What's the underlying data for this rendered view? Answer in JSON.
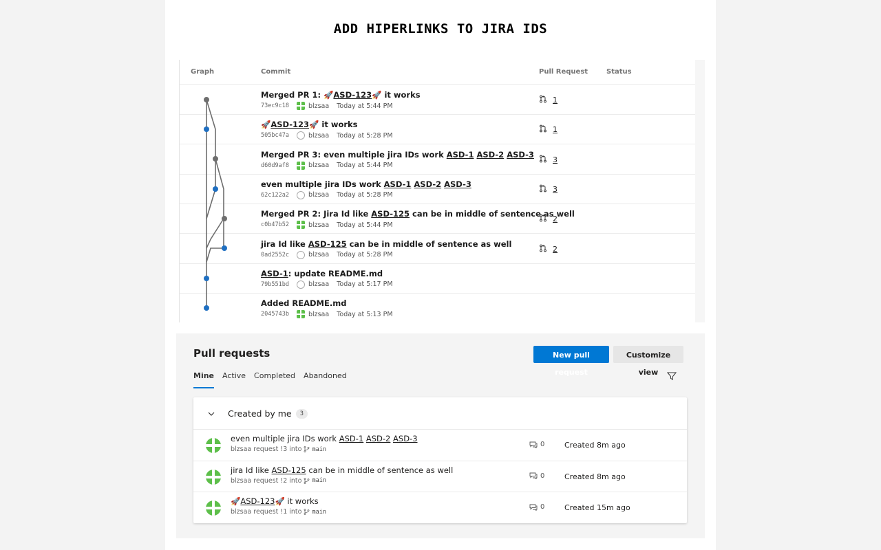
{
  "page_title": "ADD HIPERLINKS TO JIRA IDS",
  "commits_table": {
    "columns": {
      "graph": "Graph",
      "commit": "Commit",
      "pull_request": "Pull Request",
      "status": "Status"
    },
    "rows": [
      {
        "parts": [
          {
            "t": "Merged PR 1: 🚀"
          },
          {
            "l": "ASD-123"
          },
          {
            "t": "🚀 it works"
          }
        ],
        "hash": "73ec9c18",
        "avatar": "green",
        "author": "blzsaa",
        "time": "Today at 5:44 PM",
        "pr": "1"
      },
      {
        "parts": [
          {
            "t": "🚀"
          },
          {
            "l": "ASD-123"
          },
          {
            "t": "🚀 it works"
          }
        ],
        "hash": "505bc47a",
        "avatar": "grey",
        "author": "blzsaa",
        "time": "Today at 5:28 PM",
        "pr": "1"
      },
      {
        "parts": [
          {
            "t": "Merged PR 3: even multiple jira IDs work "
          },
          {
            "l": "ASD-1"
          },
          {
            "t": " "
          },
          {
            "l": "ASD-2"
          },
          {
            "t": " "
          },
          {
            "l": "ASD-3"
          }
        ],
        "hash": "d60d9af8",
        "avatar": "green",
        "author": "blzsaa",
        "time": "Today at 5:44 PM",
        "pr": "3"
      },
      {
        "parts": [
          {
            "t": "even multiple jira IDs work "
          },
          {
            "l": "ASD-1"
          },
          {
            "t": " "
          },
          {
            "l": "ASD-2"
          },
          {
            "t": " "
          },
          {
            "l": "ASD-3"
          }
        ],
        "hash": "62c122a2",
        "avatar": "grey",
        "author": "blzsaa",
        "time": "Today at 5:28 PM",
        "pr": "3"
      },
      {
        "parts": [
          {
            "t": "Merged PR 2: Jira Id like "
          },
          {
            "l": "ASD-125"
          },
          {
            "t": " can be in middle of sentence as well"
          }
        ],
        "hash": "c0b47b52",
        "avatar": "green",
        "author": "blzsaa",
        "time": "Today at 5:44 PM",
        "pr": "2"
      },
      {
        "parts": [
          {
            "t": "jira Id like "
          },
          {
            "l": "ASD-125"
          },
          {
            "t": " can be in middle of sentence as well"
          }
        ],
        "hash": "0ad2552c",
        "avatar": "grey",
        "author": "blzsaa",
        "time": "Today at 5:28 PM",
        "pr": "2"
      },
      {
        "parts": [
          {
            "l": "ASD-1"
          },
          {
            "t": ": update README.md"
          }
        ],
        "hash": "79b551bd",
        "avatar": "grey",
        "author": "blzsaa",
        "time": "Today at 5:17 PM",
        "pr": ""
      },
      {
        "parts": [
          {
            "t": "Added README.md"
          }
        ],
        "hash": "2045743b",
        "avatar": "green",
        "author": "blzsaa",
        "time": "Today at 5:13 PM",
        "pr": ""
      }
    ]
  },
  "pull_requests": {
    "heading": "Pull requests",
    "new_button": "New pull request",
    "customize_button": "Customize view",
    "tabs": [
      "Mine",
      "Active",
      "Completed",
      "Abandoned"
    ],
    "active_tab": "Mine",
    "group": {
      "label": "Created by me",
      "count": "3"
    },
    "items": [
      {
        "parts": [
          {
            "t": "even multiple jira IDs work "
          },
          {
            "l": "ASD-1"
          },
          {
            "t": " "
          },
          {
            "l": "ASD-2"
          },
          {
            "t": " "
          },
          {
            "l": "ASD-3"
          }
        ],
        "sub": "blzsaa request !3 into",
        "branch": "main",
        "comments": "0",
        "created": "Created 8m ago"
      },
      {
        "parts": [
          {
            "t": "jira Id like "
          },
          {
            "l": "ASD-125"
          },
          {
            "t": " can be in middle of sentence as well"
          }
        ],
        "sub": "blzsaa request !2 into",
        "branch": "main",
        "comments": "0",
        "created": "Created 8m ago"
      },
      {
        "parts": [
          {
            "t": "🚀"
          },
          {
            "l": "ASD-123"
          },
          {
            "t": "🚀 it works"
          }
        ],
        "sub": "blzsaa request !1 into",
        "branch": "main",
        "comments": "0",
        "created": "Created 15m ago"
      }
    ]
  },
  "colors": {
    "accent": "#0078d4",
    "graph_merge": "#6e6e6e",
    "graph_commit": "#1f6fc1",
    "avatar_green": "#5dbf4a"
  },
  "icons": {
    "pr": "pull-request-icon",
    "filter": "filter-icon",
    "chevron": "chevron-down-icon",
    "comment": "comment-icon",
    "branch": "branch-icon"
  }
}
